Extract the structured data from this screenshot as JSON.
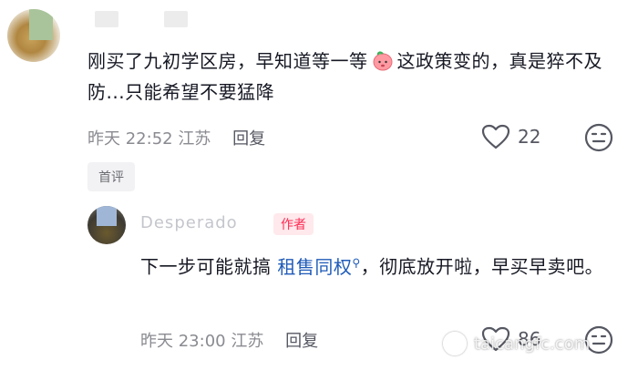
{
  "comment": {
    "text_part1": "刚买了九初学区房，早知道等一等",
    "text_part2": "这政策变的，真是猝不及防...只能希望不要猛降",
    "time": "昨天 22:52",
    "location": "江苏",
    "reply_label": "回复",
    "like_count": "22",
    "badge": "首评"
  },
  "reply": {
    "username": "Desperado",
    "author_tag": "作者",
    "text_before": "下一步可能就搞 ",
    "search_term": "租售同权",
    "text_after": "，彻底放开啦，早买早卖吧。",
    "time": "昨天 23:00",
    "location": "江苏",
    "reply_label": "回复",
    "like_count": "86"
  },
  "watermark": "taicangfc.com",
  "colors": {
    "link": "#1f5bb8",
    "author_tag": "#fe2c55",
    "meta_text": "#8a8b91"
  }
}
